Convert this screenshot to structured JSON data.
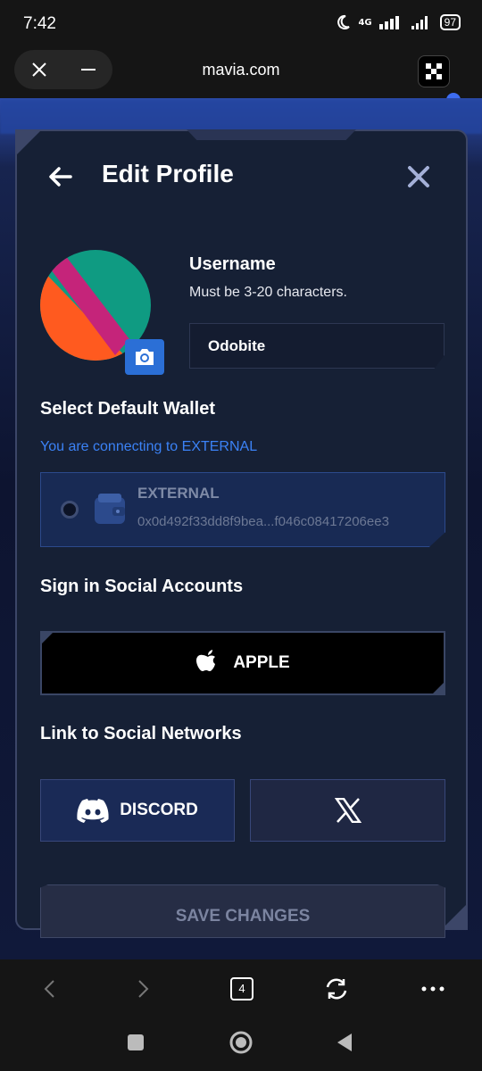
{
  "status_bar": {
    "time": "7:42",
    "network": "4G",
    "battery": "97"
  },
  "browser": {
    "url": "mavia.com",
    "tabs_count": "4"
  },
  "modal": {
    "title": "Edit Profile",
    "username": {
      "label": "Username",
      "hint": "Must be 3-20 characters.",
      "value": "Odobite"
    },
    "wallet_section": {
      "title": "Select Default Wallet",
      "connect_info": "You are connecting to EXTERNAL",
      "wallet": {
        "name": "EXTERNAL",
        "address": "0x0d492f33dd8f9bea...f046c08417206ee3"
      }
    },
    "social_accounts": {
      "title": "Sign in Social Accounts",
      "apple_label": "APPLE"
    },
    "social_networks": {
      "title": "Link to Social Networks",
      "discord_label": "DISCORD"
    },
    "save_label": "SAVE CHANGES"
  },
  "colors": {
    "accent": "#3b82f6",
    "modal_bg": "#162035",
    "camera_button": "#2b6fd6",
    "discord_bg": "#1a2a56"
  },
  "icons": [
    "close-icon",
    "minimize-icon",
    "back-arrow-icon",
    "camera-icon",
    "wallet-icon",
    "apple-icon",
    "discord-icon",
    "x-logo-icon",
    "refresh-icon",
    "more-icon"
  ]
}
